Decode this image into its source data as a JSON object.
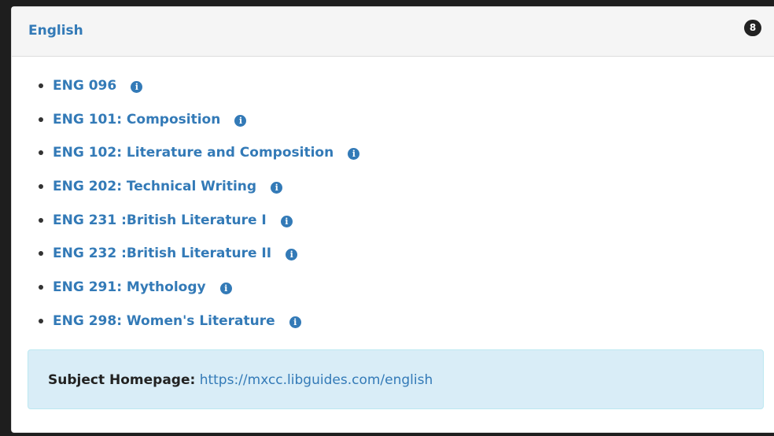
{
  "panel": {
    "title": "English",
    "count": "8"
  },
  "guides": [
    {
      "label": "ENG 096"
    },
    {
      "label": "ENG 101: Composition"
    },
    {
      "label": "ENG 102: Literature and Composition"
    },
    {
      "label": "ENG 202: Technical Writing"
    },
    {
      "label": "ENG 231 :British Literature I"
    },
    {
      "label": "ENG 232 :British Literature II"
    },
    {
      "label": "ENG 291: Mythology"
    },
    {
      "label": "ENG 298: Women's Literature"
    }
  ],
  "info_icon": {
    "name": "info-circle-icon",
    "glyph": "i"
  },
  "homepage": {
    "label": "Subject Homepage:",
    "url": "https://mxcc.libguides.com/english"
  },
  "colors": {
    "link": "#337ab7",
    "heading_bg": "#f5f5f5",
    "info_box_bg": "#d9edf7",
    "badge_bg": "#222222"
  }
}
